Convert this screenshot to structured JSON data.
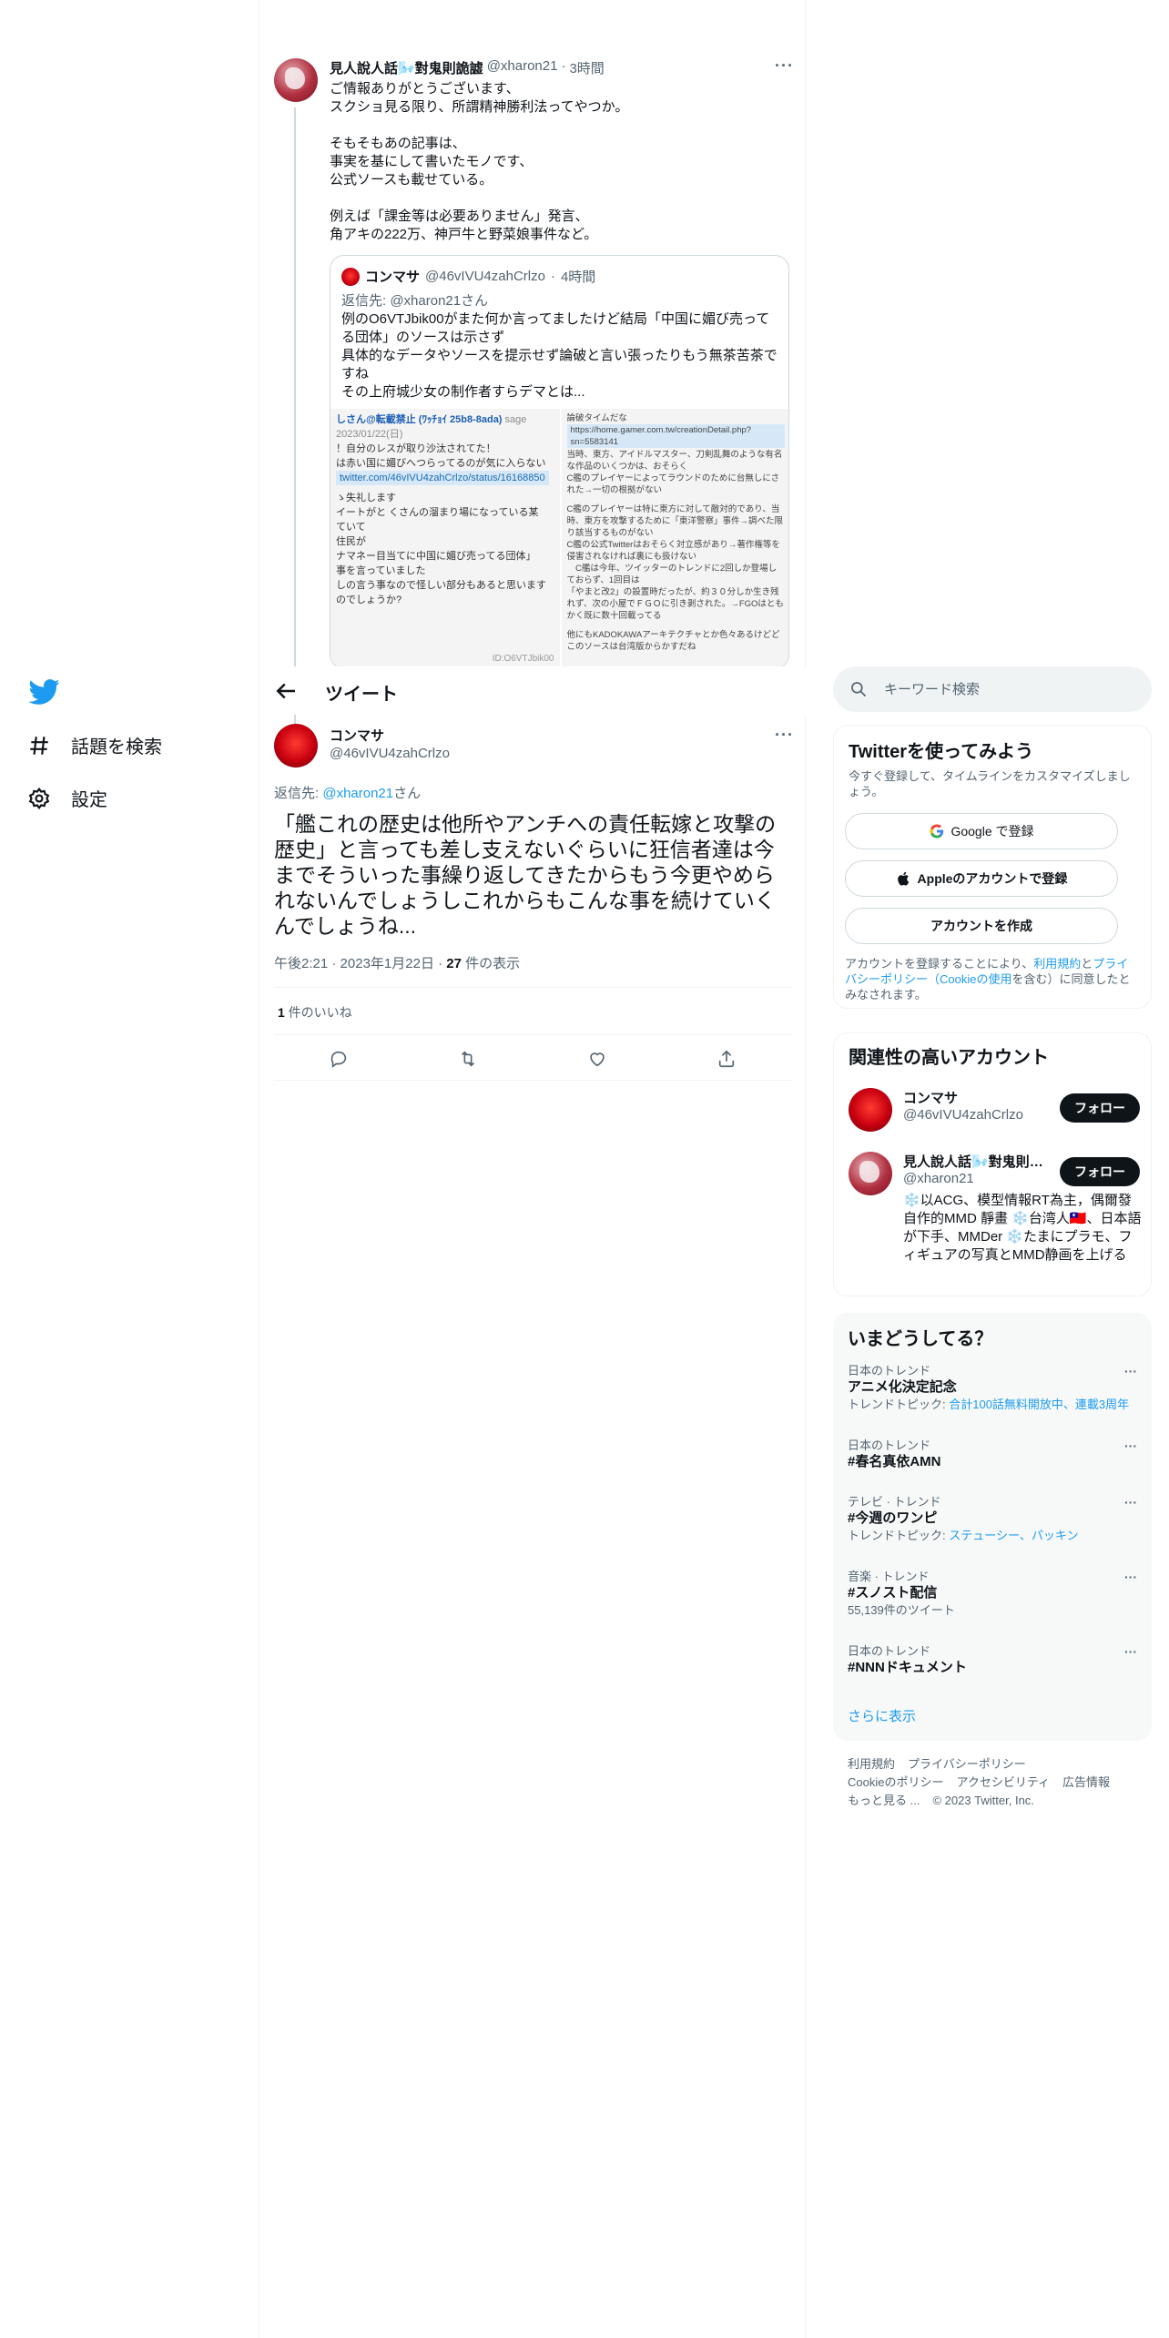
{
  "nav": {
    "items": [
      {
        "label": "話題を検索",
        "icon": "hashtag-icon"
      },
      {
        "label": "設定",
        "icon": "gear-icon"
      }
    ]
  },
  "parent_tweet": {
    "name": "見人說人話🌬️對鬼則詭譃",
    "handle": "@xharon21",
    "dot": "·",
    "time": "3時間",
    "text": "ご情報ありがとうございます、\nスクショ見る限り、所謂精神勝利法ってやつか。\n\nそもそもあの記事は、\n事実を基にして書いたモノです、\n公式ソースも載せている。\n\n例えば「課金等は必要ありません」発言、\n角アキの222万、神戸牛と野菜娘事件など。",
    "quote": {
      "name": "コンマサ",
      "handle": "@46vIVU4zahCrlzo",
      "dot": "·",
      "time": "4時間",
      "reply": "返信先: @xharon21さん",
      "text": "例のO6VTJbik00がまた何か言ってましたけど結局「中国に媚び売ってる団体」のソースは示さず\n具体的なデータやソースを提示せず論破と言い張ったりもう無茶苦茶ですね\nその上府城少女の制作者すらデマとは...",
      "image_left": {
        "header": "しさん@転載禁止 (ﾜｯﾁｮｲ 25b8-8ada)",
        "header_meta": "sage 2023/01/22(日)",
        "lines": [
          "！自分のレスが取り沙汰されてた！",
          "は赤い国に媚びへつらってるのが気に入らない"
        ],
        "link": "twitter.com/46vIVU4zahCrlzo/status/16168850",
        "lines2": [
          "ゝ失礼します",
          "イートがと くさんの溜まり場になっている某",
          "ていて",
          "住民が",
          "ナマネー目当てに中国に媚び売ってる団体」",
          "事を言っていました",
          "しの言う事なので怪しい部分もあると思います",
          "のでしょうか?"
        ],
        "id": "ID:O6VTJbik00"
      },
      "image_right": {
        "header": "論破タイムだな",
        "link": "https://home.gamer.com.tw/creationDetail.php?sn=5583141",
        "lines": [
          "当時、東方、アイドルマスター、刀剣乱舞のような有名な作品のいくつかは、おそらく",
          "C艦のプレイヤーによってラウンドのために台無しにされた→一切の根拠がない",
          "",
          "C艦のプレイヤーは特に東方に対して敵対的であり、当時、東方を攻撃するために「東洋警察」事件→調べた限り該当するものがない",
          "C艦の公式Twitterはおそらく対立感があり→著作権等を侵害されなければ裏にも扱けない",
          "　C艦は今年、ツイッターのトレンドに2回しか登場しておらず、1回目は",
          "「やまと改2」の設置時だったが、約３０分しか生き残れず、次の小屋でＦＧＯに引き剥された。→FGOはともかく既に数十回載ってる",
          "",
          "他にもKADOKAWAアーキテクチャとか色々あるけどどこのソースは台湾版からかすだね"
        ]
      }
    }
  },
  "header": {
    "title": "ツイート"
  },
  "main_tweet": {
    "name": "コンマサ",
    "handle": "@46vIVU4zahCrlzo",
    "reply_prefix": "返信先: ",
    "reply_handle": "@xharon21",
    "reply_suffix": "さん",
    "text": "「艦これの歴史は他所やアンチへの責任転嫁と攻撃の歴史」と言っても差し支えないぐらいに狂信者達は今までそういった事繰り返してきたからもう今更やめられないんでしょうしこれからもこんな事を続けていくんでしょうね...",
    "time": "午後2:21",
    "date": "2023年1月22日",
    "views_count": "27",
    "views_label": "件の表示",
    "sep": "·",
    "likes_count": "1",
    "likes_label": "件のいいね"
  },
  "search": {
    "placeholder": "キーワード検索"
  },
  "signup": {
    "title": "Twitterを使ってみよう",
    "desc": "今すぐ登録して、タイムラインをカスタマイズしましょう。",
    "google": "Google で登録",
    "apple": "Appleのアカウントで登録",
    "create": "アカウントを作成",
    "legal_1": "アカウントを登録することにより、",
    "legal_terms": "利用規約",
    "legal_2": "と",
    "legal_privacy": "プライバシーポリシー（Cookieの使用",
    "legal_3": "を含む）に同意したとみなされます。"
  },
  "related": {
    "title": "関連性の高いアカウント",
    "users": [
      {
        "name": "コンマサ",
        "handle": "@46vIVU4zahCrlzo",
        "follow": "フォロー",
        "bio": ""
      },
      {
        "name": "見人說人話🌬️對鬼則詭譃",
        "handle": "@xharon21",
        "follow": "フォロー",
        "bio": "❄️以ACG、模型情報RT為主，偶爾發自作的MMD 靜畫 ❄️台湾人🇹🇼、日本語が下手、MMDer ❄️たまにプラモ、フィギュアの写真とMMD静画を上げる"
      }
    ]
  },
  "trends": {
    "title": "いまどうしてる？",
    "items": [
      {
        "context": "日本のトレンド",
        "name": "アニメ化決定記念",
        "sub_prefix": "トレンドトピック: ",
        "sub_links": "合計100話無料開放中、連載3周年"
      },
      {
        "context": "日本のトレンド",
        "name": "#春名真依AMN",
        "sub_prefix": "",
        "sub_links": ""
      },
      {
        "context": "テレビ · トレンド",
        "name": "#今週のワンピ",
        "sub_prefix": "トレンドトピック: ",
        "sub_links": "ステューシー、パッキン"
      },
      {
        "context": "音楽 · トレンド",
        "name": "#スノスト配信",
        "sub_prefix": "55,139件のツイート",
        "sub_links": ""
      },
      {
        "context": "日本のトレンド",
        "name": "#NNNドキュメント",
        "sub_prefix": "",
        "sub_links": ""
      }
    ],
    "show_more": "さらに表示"
  },
  "footer": {
    "links": [
      "利用規約",
      "プライバシーポリシー",
      "Cookieのポリシー",
      "アクセシビリティ",
      "広告情報",
      "もっと見る ..."
    ],
    "copyright": "© 2023 Twitter, Inc."
  },
  "colors": {
    "accent": "#1d9bf0",
    "text": "#0f1419",
    "secondary": "#536471",
    "border": "#eff3f4"
  }
}
